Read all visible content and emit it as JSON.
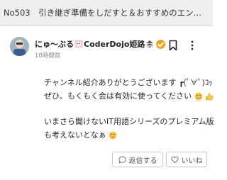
{
  "header": {
    "title": "No503　引き継ぎ準備をしだすと＆おすすめのエン…"
  },
  "comment": {
    "author_prefix": "にゅ～ぶる",
    "author_name": "CoderDojo姫路",
    "timestamp": "10時間前",
    "lines": [
      "チャンネル紹介ありがとうございます ┏(ﾟ∀ﾟ)ｺｯ",
      "ぜひ、もくもく会は有効に使ってください",
      "いまさら聞けないIT用語シリーズのプレミアム版",
      "も考えないとなぁ"
    ]
  },
  "actions": {
    "reply_label": "返信する",
    "like_label": "いいね"
  },
  "colors": {
    "header_bg": "#eeeeee",
    "badge": "#f0a020"
  }
}
